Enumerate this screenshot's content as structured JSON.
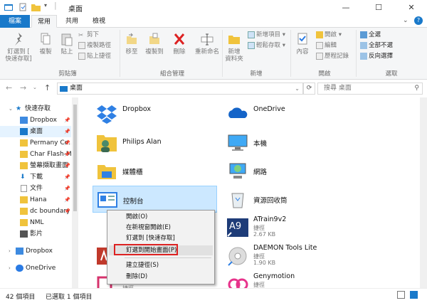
{
  "window": {
    "title": "桌面",
    "minimize": "—",
    "maximize": "☐",
    "close": "✕"
  },
  "ribbon_tabs": [
    "檔案",
    "常用",
    "共用",
    "檢視"
  ],
  "ribbon": {
    "pin_label": "釘選到 [\n快速存取]",
    "copy": "複製",
    "paste": "貼上",
    "cut": "剪下",
    "copy_path": "複製路徑",
    "paste_shortcut": "貼上捷徑",
    "clipboard_group": "剪貼簿",
    "move_to": "移至",
    "copy_to": "複製到",
    "delete": "刪除",
    "rename": "重新命名",
    "organize_group": "組合管理",
    "new_folder": "新增\n資料夾",
    "new_item": "新增項目 ▾",
    "easy_access": "輕鬆存取 ▾",
    "new_group": "新增",
    "properties": "內容",
    "open": "開啟 ▾",
    "edit": "編輯",
    "history": "歷程記錄",
    "open_group": "開啟",
    "select_all": "全選",
    "select_none": "全部不選",
    "invert_selection": "反向選擇",
    "select_group": "選取"
  },
  "address": {
    "path": "桌面",
    "search_placeholder": "搜尋 桌面",
    "back": "←",
    "forward": "→",
    "up": "↑",
    "refresh": "⟳"
  },
  "nav": {
    "items": [
      {
        "label": "快速存取",
        "pinned": false
      },
      {
        "label": "Dropbox",
        "pinned": true
      },
      {
        "label": "桌面",
        "pinned": true
      },
      {
        "label": "Permany Co...",
        "pinned": true
      },
      {
        "label": "Char Flash-M...",
        "pinned": true
      },
      {
        "label": "螢幕擷取畫面",
        "pinned": true
      },
      {
        "label": "下載",
        "pinned": true
      },
      {
        "label": "文件",
        "pinned": true
      },
      {
        "label": "Hana",
        "pinned": true
      },
      {
        "label": "dc boundary",
        "pinned": true
      },
      {
        "label": "NML",
        "pinned": false
      },
      {
        "label": "影片",
        "pinned": false
      },
      {
        "label": "Dropbox",
        "pinned": false
      },
      {
        "label": "OneDrive",
        "pinned": false
      }
    ],
    "pin_glyph": "📌"
  },
  "files": {
    "dropbox": "Dropbox",
    "onedrive": "OneDrive",
    "philips": "Philips Alan",
    "thispc": "本機",
    "libraries": "媒體櫃",
    "network": "網路",
    "control": "控制台",
    "recycle": "資源回收筒",
    "atrain": "ATrain9v2",
    "atrain_type": "捷徑",
    "atrain_size": "2.67 KB",
    "daemon": "DAEMON Tools Lite",
    "daemon_type": "捷徑",
    "daemon_size": "1.90 KB",
    "genymotion": "Genymotion",
    "genymotion_type": "捷徑",
    "bottom_partial": "捷徑"
  },
  "context_menu": {
    "open": "開啟(O)",
    "open_new_window": "在新視窗開啟(E)",
    "pin_quick": "釘選到 [快速存取]",
    "pin_start": "釘選到開始畫面(P)",
    "create_shortcut": "建立捷徑(S)",
    "delete": "刪除(D)"
  },
  "status": {
    "count": "42 個項目",
    "selected": "已選取 1 個項目"
  },
  "colors": {
    "accent": "#1979ca",
    "selection": "#cce8ff",
    "highlight_border": "#dd2222"
  }
}
